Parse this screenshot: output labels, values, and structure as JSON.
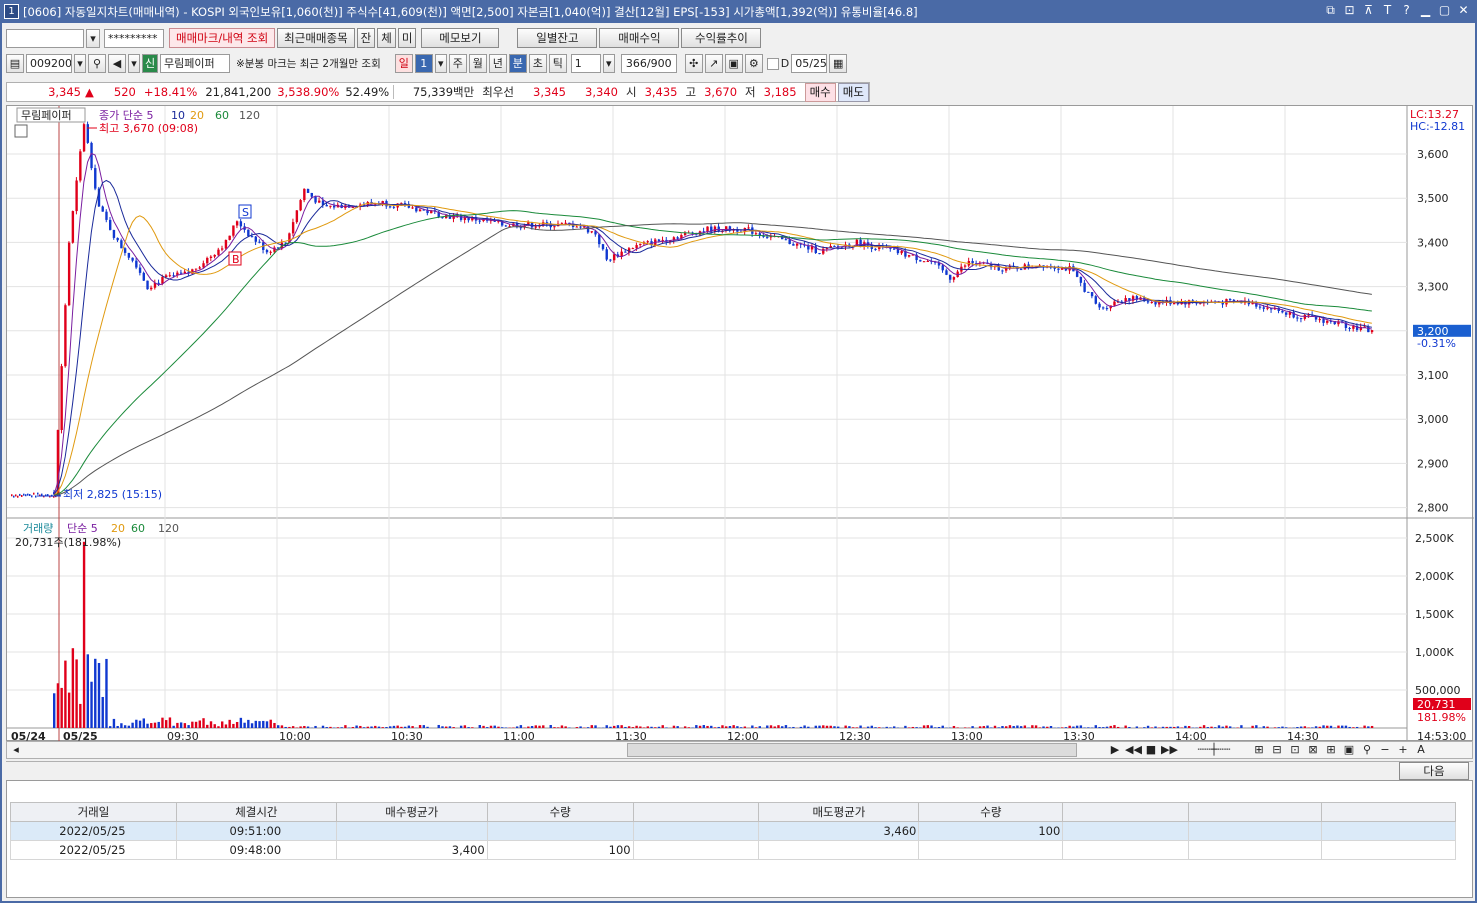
{
  "window": {
    "id_badge": "1",
    "title": "[0606] 자동일지차트(매매내역) - KOSPI 외국인보유[1,060(천)] 주식수[41,609(천)] 액면[2,500] 자본금[1,040(억)] 결산[12월] EPS[-153] 시가총액[1,392(억)] 유통비율[46.8]",
    "controls": [
      "⧉",
      "⊡",
      "⊼",
      "T",
      "?",
      "▁",
      "▢",
      "✕"
    ]
  },
  "toolbar1": {
    "account_value": "",
    "password_mask": "*********",
    "tab_active": "매매마크/내역 조회",
    "tabs": [
      "최근매매종목",
      "잔",
      "체",
      "미"
    ],
    "memo_button": "메모보기",
    "buttons": [
      "일별잔고",
      "매매수익",
      "수익률추이"
    ]
  },
  "toolbar2": {
    "code": "009200",
    "credit_badge": "신",
    "stock_name": "무림페이퍼",
    "notice": "※분봉 마크는 최근 2개월만 조회",
    "periods": [
      "일",
      "1",
      "주",
      "월",
      "년",
      "분",
      "초",
      "틱"
    ],
    "interval": "1",
    "count": "366/900",
    "date_label": "D",
    "date": "05/25"
  },
  "quote": {
    "price": "3,345",
    "arrow": "▲",
    "change": "520",
    "change_pct": "+18.41%",
    "volume": "21,841,200",
    "vol_pct": "3,538.90%",
    "ratio": "52.49%",
    "amount": "75,339백만",
    "pref_label": "최우선",
    "best_ask": "3,345",
    "best_bid": "3,340",
    "open_label": "시",
    "open": "3,435",
    "high_label": "고",
    "high": "3,670",
    "low_label": "저",
    "low": "3,185",
    "buy": "매수",
    "sell": "매도"
  },
  "chart": {
    "stock_tag": "무림페이퍼",
    "ma_label": "종가 단순 5",
    "ma_periods": [
      "10",
      "20",
      "60",
      "120"
    ],
    "high_note": "최고 3,670 (09:08)",
    "low_note": "최저 2,825 (15:15)",
    "lc": "LC:13.27",
    "hc": "HC:-12.81",
    "price_ticks": [
      "3,600",
      "3,500",
      "3,400",
      "3,300",
      "3,200",
      "3,100",
      "3,000",
      "2,900",
      "2,800"
    ],
    "current_price": "3,200",
    "current_pct": "-0.31%",
    "vol_label": "거래량",
    "vol_ma_label": "단순 5",
    "vol_ma_periods": [
      "20",
      "60",
      "120"
    ],
    "vol_value": "20,731주(181.98%)",
    "vol_ticks": [
      "2,500K",
      "2,000K",
      "1,500K",
      "1,000K",
      "500,000"
    ],
    "vol_current": "20,731",
    "vol_current_pct": "181.98%",
    "time_labels": [
      "05/24",
      "05/25",
      "09:30",
      "10:00",
      "10:30",
      "11:00",
      "11:30",
      "12:00",
      "12:30",
      "13:00",
      "13:30",
      "14:00",
      "14:30",
      "14:53:00"
    ],
    "marker_buy": "B",
    "marker_sell": "S",
    "colors": {
      "up": "#e0001a",
      "down": "#1038d0",
      "ma5": "#7a1ea0",
      "ma10": "#1a2a9a",
      "ma20": "#e09a10",
      "ma60": "#1a8a3a",
      "ma120": "#555555"
    }
  },
  "chart_data": {
    "type": "candlestick",
    "x_range": [
      "09:00",
      "14:53"
    ],
    "ylim": [
      2800,
      3670
    ],
    "price_path": [
      [
        "09:00",
        2835
      ],
      [
        "09:04",
        3400
      ],
      [
        "09:08",
        3670
      ],
      [
        "09:12",
        3480
      ],
      [
        "09:17",
        3400
      ],
      [
        "09:22",
        3350
      ],
      [
        "09:25",
        3300
      ],
      [
        "09:30",
        3320
      ],
      [
        "09:36",
        3330
      ],
      [
        "09:42",
        3370
      ],
      [
        "09:46",
        3400
      ],
      [
        "09:49",
        3450
      ],
      [
        "09:52",
        3420
      ],
      [
        "09:57",
        3380
      ],
      [
        "10:02",
        3400
      ],
      [
        "10:07",
        3520
      ],
      [
        "10:12",
        3480
      ],
      [
        "10:20",
        3485
      ],
      [
        "10:28",
        3490
      ],
      [
        "10:35",
        3480
      ],
      [
        "10:45",
        3460
      ],
      [
        "10:55",
        3450
      ],
      [
        "11:00",
        3440
      ],
      [
        "11:10",
        3440
      ],
      [
        "11:20",
        3440
      ],
      [
        "11:25",
        3420
      ],
      [
        "11:28",
        3360
      ],
      [
        "11:35",
        3390
      ],
      [
        "11:45",
        3410
      ],
      [
        "11:55",
        3430
      ],
      [
        "12:05",
        3430
      ],
      [
        "12:15",
        3405
      ],
      [
        "12:25",
        3380
      ],
      [
        "12:35",
        3400
      ],
      [
        "12:45",
        3380
      ],
      [
        "12:55",
        3355
      ],
      [
        "13:00",
        3320
      ],
      [
        "13:05",
        3355
      ],
      [
        "13:15",
        3340
      ],
      [
        "13:25",
        3350
      ],
      [
        "13:32",
        3340
      ],
      [
        "13:40",
        3250
      ],
      [
        "13:47",
        3275
      ],
      [
        "13:55",
        3265
      ],
      [
        "14:05",
        3265
      ],
      [
        "14:20",
        3265
      ],
      [
        "14:30",
        3240
      ],
      [
        "14:42",
        3220
      ],
      [
        "14:53",
        3200
      ]
    ]
  },
  "bottom": {
    "next_button": "다음",
    "columns": [
      "거래일",
      "체결시간",
      "매수평균가",
      "수량",
      "",
      "매도평균가",
      "수량",
      "",
      "",
      ""
    ],
    "rows": [
      [
        "2022/05/25",
        "09:51:00",
        "",
        "",
        "",
        "3,460",
        "100",
        "",
        "",
        ""
      ],
      [
        "2022/05/25",
        "09:48:00",
        "3,400",
        "100",
        "",
        "",
        "",
        "",
        "",
        ""
      ]
    ]
  }
}
